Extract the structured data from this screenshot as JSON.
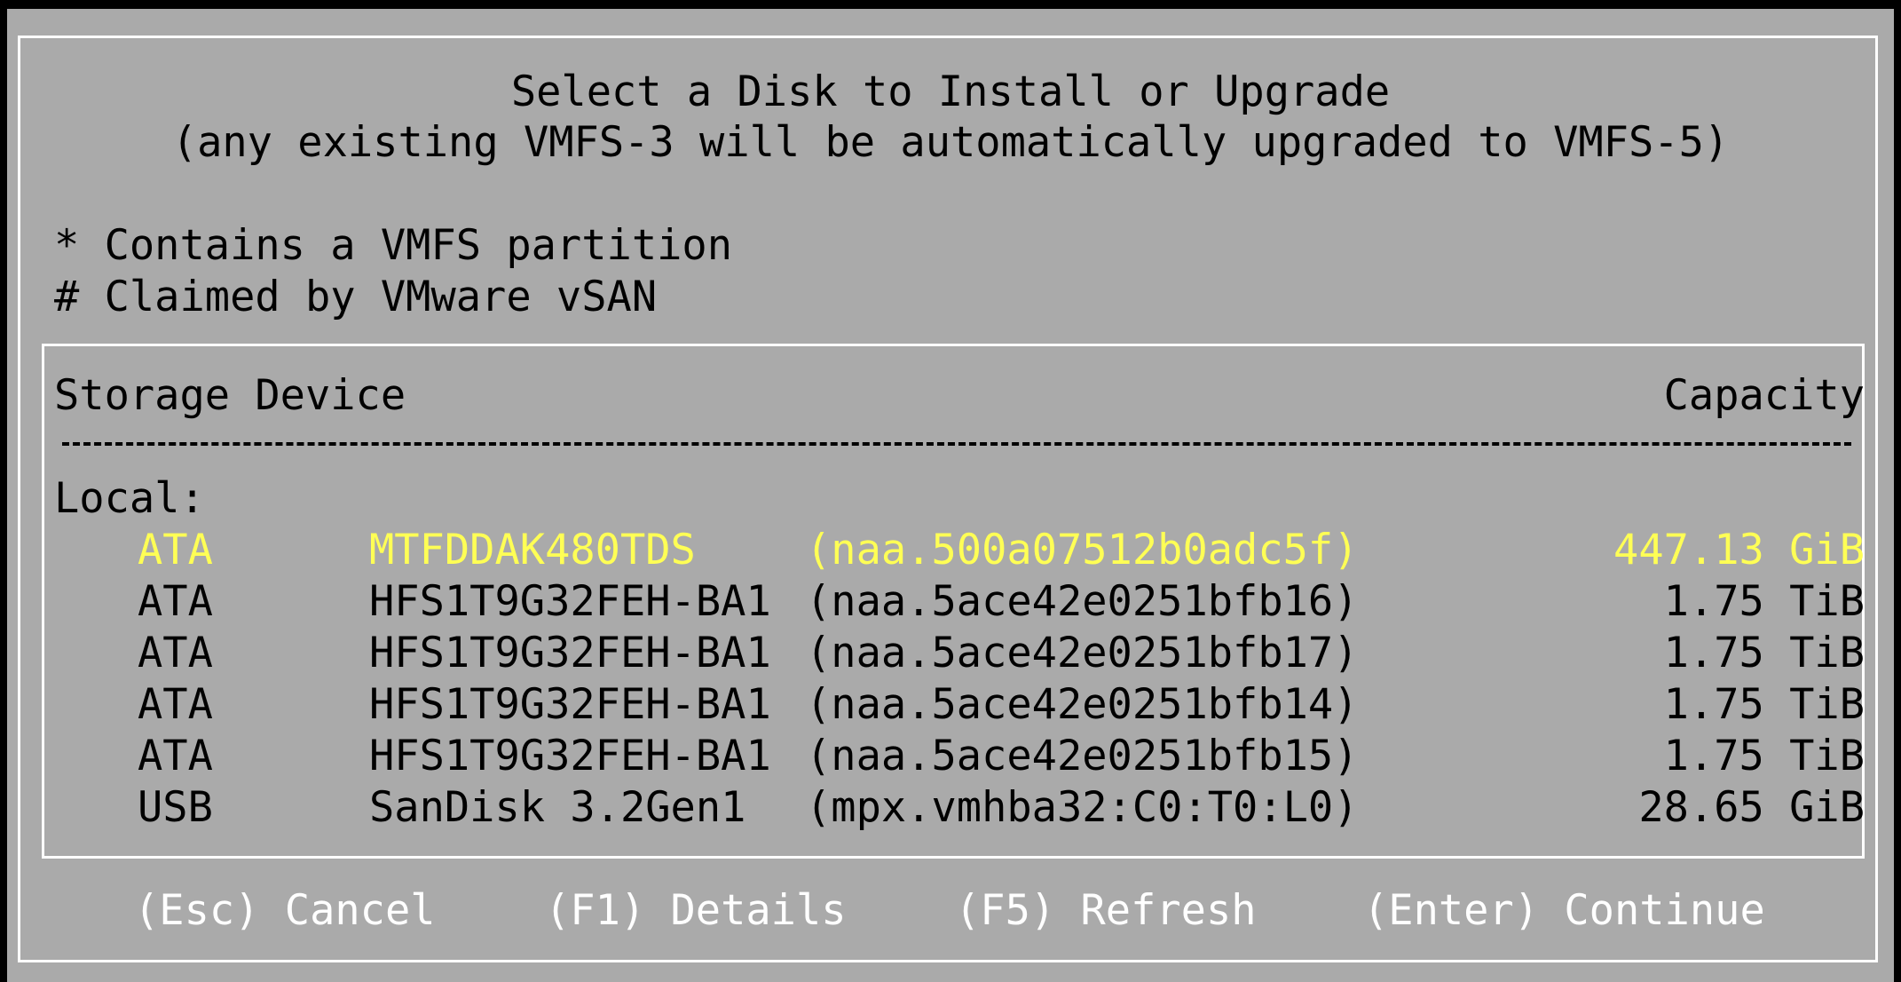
{
  "dialog": {
    "title": "Select a Disk to Install or Upgrade",
    "subtitle": "(any existing VMFS-3 will be automatically upgraded to VMFS-5)",
    "legend": [
      "* Contains a VMFS partition",
      "# Claimed by VMware vSAN"
    ]
  },
  "table": {
    "headers": {
      "device": "Storage Device",
      "capacity": "Capacity"
    },
    "group_label": "Local:",
    "rows": [
      {
        "bus": "ATA",
        "model": "MTFDDAK480TDS",
        "id": "(naa.500a07512b0adc5f)",
        "capacity": "447.13 GiB",
        "selected": true
      },
      {
        "bus": "ATA",
        "model": "HFS1T9G32FEH-BA1",
        "id": "(naa.5ace42e0251bfb16)",
        "capacity": "1.75 TiB",
        "selected": false
      },
      {
        "bus": "ATA",
        "model": "HFS1T9G32FEH-BA1",
        "id": "(naa.5ace42e0251bfb17)",
        "capacity": "1.75 TiB",
        "selected": false
      },
      {
        "bus": "ATA",
        "model": "HFS1T9G32FEH-BA1",
        "id": "(naa.5ace42e0251bfb14)",
        "capacity": "1.75 TiB",
        "selected": false
      },
      {
        "bus": "ATA",
        "model": "HFS1T9G32FEH-BA1",
        "id": "(naa.5ace42e0251bfb15)",
        "capacity": "1.75 TiB",
        "selected": false
      },
      {
        "bus": "USB",
        "model": "SanDisk 3.2Gen1",
        "id": "(mpx.vmhba32:C0:T0:L0)",
        "capacity": "28.65 GiB",
        "selected": false
      }
    ]
  },
  "footer": {
    "cancel": "(Esc) Cancel",
    "details": "(F1) Details",
    "refresh": "(F5) Refresh",
    "continue": "(Enter) Continue"
  },
  "colors": {
    "background": "#aaaaaa",
    "text": "#000000",
    "highlight": "#ffff55",
    "footer_text": "#ffffff",
    "border": "#ffffff"
  }
}
